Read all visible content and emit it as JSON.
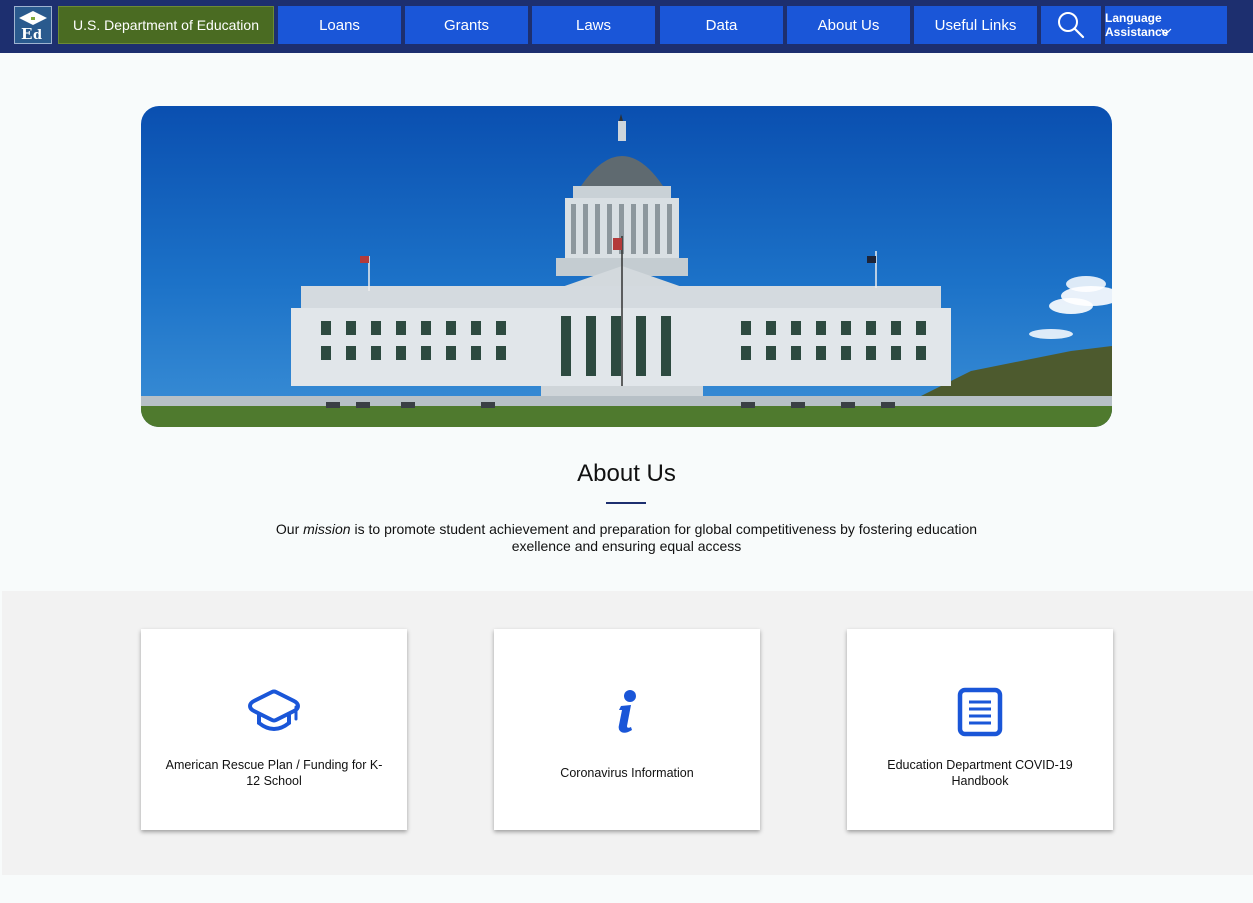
{
  "header": {
    "dept_name": "U.S. Department of Education",
    "nav": [
      {
        "label": "Loans"
      },
      {
        "label": "Grants"
      },
      {
        "label": "Laws"
      },
      {
        "label": "Data"
      },
      {
        "label": "About Us"
      },
      {
        "label": "Useful Links"
      }
    ],
    "language_label": "Language Assistance"
  },
  "about": {
    "title": "About Us",
    "mission_prefix": "Our ",
    "mission_emph": "mission",
    "mission_rest": " is to promote student achievement and preparation for global competitiveness by fostering education exellence and ensuring equal access"
  },
  "cards": [
    {
      "label": "American Rescue Plan / Funding for K-12 School",
      "icon": "graduation-cap-icon"
    },
    {
      "label": "Coronavirus Information",
      "icon": "info-icon"
    },
    {
      "label": "Education Department COVID-19 Handbook",
      "icon": "document-icon"
    }
  ],
  "colors": {
    "nav_bg": "#1d2f6f",
    "button_blue": "#1a56d8",
    "dept_green": "#4a6b22",
    "icon_blue": "#1a56d8"
  }
}
